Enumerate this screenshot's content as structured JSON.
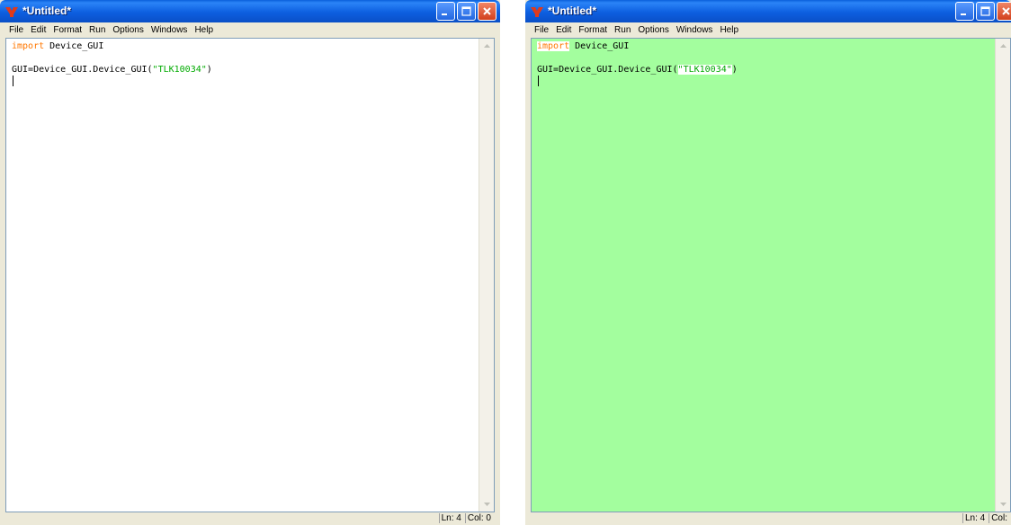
{
  "window_title": "*Untitled*",
  "menu": [
    "File",
    "Edit",
    "Format",
    "Run",
    "Options",
    "Windows",
    "Help"
  ],
  "code": {
    "line1_keyword": "import",
    "line1_rest": " Device_GUI",
    "line3_prefix": "GUI=Device_GUI.Device_GUI(",
    "line3_string": "\"TLK10034\"",
    "line3_suffix": ")"
  },
  "left_status": {
    "ln": "Ln: 4",
    "col": "Col: 0"
  },
  "right_status": {
    "ln": "Ln: 4",
    "col": "Col:"
  },
  "colors": {
    "keyword": "#ff7700",
    "string": "#00aa00",
    "highlight_background": "#a3fe9e",
    "titlebar": "#0a5fda"
  },
  "icons": {
    "app": "python-idle-icon",
    "minimize": "minimize-icon",
    "maximize": "maximize-icon",
    "close": "close-icon"
  }
}
